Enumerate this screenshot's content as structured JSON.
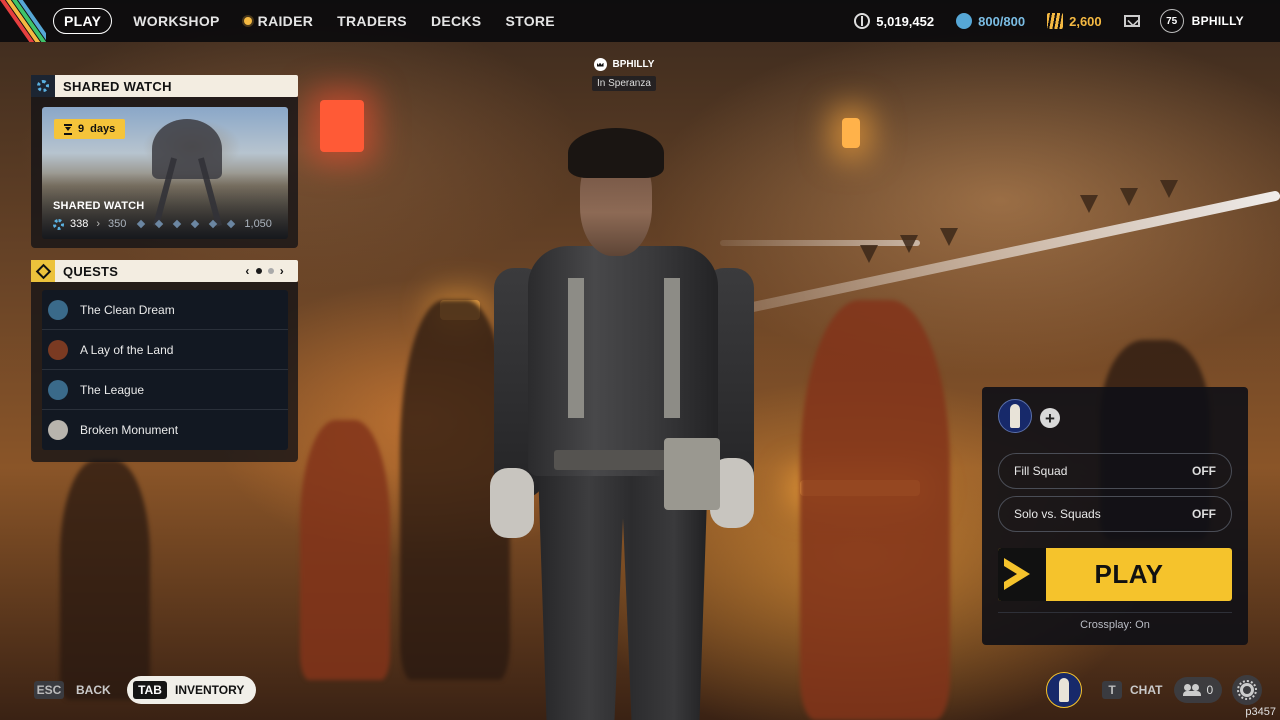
{
  "nav": {
    "items": [
      {
        "label": "PLAY",
        "active": true
      },
      {
        "label": "WORKSHOP"
      },
      {
        "label": "RAIDER",
        "icon": "raider-dot-icon"
      },
      {
        "label": "TRADERS"
      },
      {
        "label": "DECKS"
      },
      {
        "label": "STORE"
      }
    ]
  },
  "currencies": {
    "coins": "5,019,452",
    "credits": "800/800",
    "raider_tokens": "2,600"
  },
  "player": {
    "level": "75",
    "name": "BPHILLY",
    "location": "In Speranza"
  },
  "shared_watch": {
    "header": "SHARED WATCH",
    "days_value": "9",
    "days_label": "days",
    "card_title": "SHARED WATCH",
    "current": "338",
    "next": "350",
    "max": "1,050"
  },
  "quests": {
    "header": "QUESTS",
    "page": 1,
    "pages": 2,
    "items": [
      {
        "label": "The Clean Dream",
        "color": "#3a6a8a"
      },
      {
        "label": "A Lay of the Land",
        "color": "#7a3a22"
      },
      {
        "label": "The League",
        "color": "#3a6a8a"
      },
      {
        "label": "Broken Monument",
        "color": "#b8b4ad"
      }
    ]
  },
  "squad": {
    "fill_squad_label": "Fill Squad",
    "fill_squad_state": "OFF",
    "solo_label": "Solo vs. Squads",
    "solo_state": "OFF",
    "play_label": "PLAY",
    "crossplay": "Crossplay: On"
  },
  "bottom": {
    "esc_key": "ESC",
    "back_label": "BACK",
    "tab_key": "TAB",
    "inventory_label": "INVENTORY",
    "chat_key": "T",
    "chat_label": "CHAT",
    "friends_count": "0",
    "build": "p3457"
  },
  "colors": {
    "accent": "#f5c32c",
    "credits": "#56a7d6",
    "raider_tokens": "#f5b942",
    "panel_header": "#f3ede1"
  }
}
